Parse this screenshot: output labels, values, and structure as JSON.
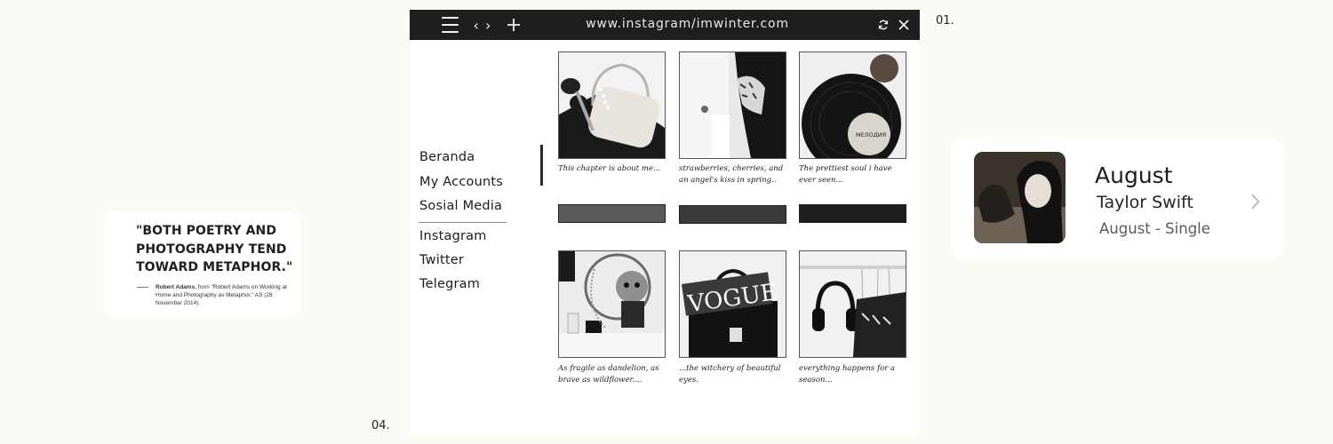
{
  "labels": {
    "top_right": "01.",
    "bottom_left": "04."
  },
  "quote": {
    "text": "\"BOTH POETRY AND PHOTOGRAPHY TEND TOWARD METAPHOR.\"",
    "author": "Robert Adams",
    "source": ", from \"Robert Adams on Working at Home and Photography as Metaphor,\" AS (28 November 2014)."
  },
  "browser": {
    "url": "www.instagram/imwinter.com",
    "icons": {
      "menu": "hamburger-menu-icon",
      "code": "code-brackets-icon",
      "new_tab": "plus-icon",
      "refresh": "refresh-icon",
      "close": "close-icon"
    }
  },
  "sidebar": {
    "items": [
      {
        "label": "Beranda"
      },
      {
        "label": "My Accounts"
      },
      {
        "label": "Sosial Media"
      },
      {
        "label": "Instagram"
      },
      {
        "label": "Twitter"
      },
      {
        "label": "Telegram"
      }
    ]
  },
  "posts": [
    {
      "caption": "This chapter is about me...",
      "bar_color": "#5a5a5c"
    },
    {
      "caption": "strawberries, cherries, and an angel's kiss in spring..",
      "bar_color": "#3a3a3c"
    },
    {
      "caption": "The prettiest soul i have ever seen...",
      "bar_color": "#1f1f21",
      "record_label": "МЕЛОДИЯ"
    },
    {
      "caption": "As fragile as dandelion, as brave as wildflower....",
      "bar_color": null
    },
    {
      "caption": "...the witchery of beautiful eyes.",
      "bar_color": null,
      "magazine_text": "VOGUE"
    },
    {
      "caption": "everything happens for a season...",
      "bar_color": null
    }
  ],
  "music": {
    "title": "August",
    "artist": "Taylor Swift",
    "album": "August - Single",
    "chevron": "chevron-right-icon"
  }
}
